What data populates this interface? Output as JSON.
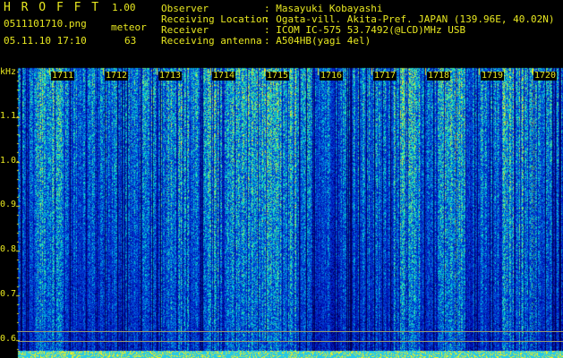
{
  "header": {
    "app_title": "H R O F F T",
    "version": "1.00",
    "filename": "0511101710.png",
    "meteor_label": "meteor",
    "datetime": "05.11.10 17:10",
    "meteor_count": "63",
    "fields": [
      {
        "label": "Observer",
        "value": ": Masayuki Kobayashi"
      },
      {
        "label": "Receiving Location",
        "value": ": Ogata-vill. Akita-Pref. JAPAN (139.96E, 40.02N)"
      },
      {
        "label": "Receiver",
        "value": ": ICOM IC-575 53.7492(@LCD)MHz USB"
      },
      {
        "label": "Receiving antenna",
        "value": ": A504HB(yagi 4el)"
      }
    ]
  },
  "axes": {
    "y_unit": "kHz",
    "y_ticks": [
      "1.1",
      "1.0",
      "0.9",
      "0.8",
      "0.7",
      "0.6"
    ],
    "x_ticks": [
      "1711",
      "1712",
      "1713",
      "1714",
      "1715",
      "1716",
      "1717",
      "1718",
      "1719",
      "1720"
    ]
  },
  "colors": {
    "text": "#e8e820",
    "text_alt": "#22c8a0",
    "background": "#000000"
  }
}
